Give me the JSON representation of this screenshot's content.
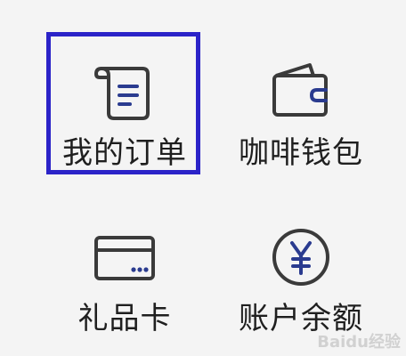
{
  "menu": {
    "items": [
      {
        "label": "我的订单",
        "icon": "receipt-icon"
      },
      {
        "label": "咖啡钱包",
        "icon": "wallet-icon"
      },
      {
        "label": "礼品卡",
        "icon": "card-icon"
      },
      {
        "label": "账户余额",
        "icon": "yen-coin-icon"
      }
    ]
  },
  "highlight_color": "#2b23c8",
  "accent_color": "#2a3b8f",
  "icon_stroke_color": "#3a3a3a",
  "watermark": "Baidu经验"
}
